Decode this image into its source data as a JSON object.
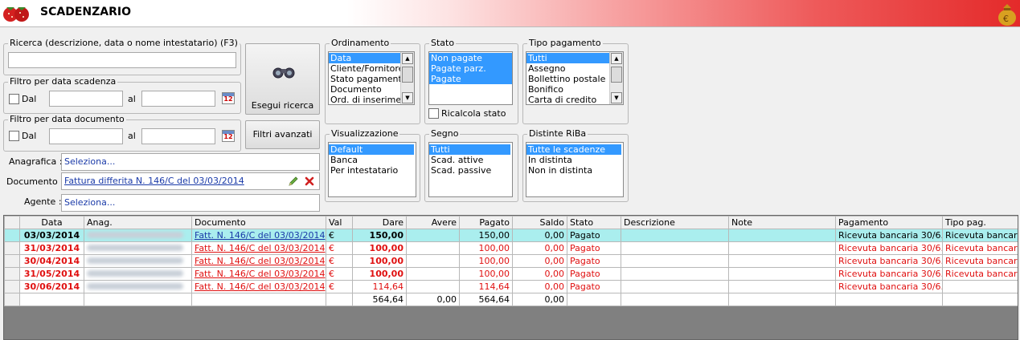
{
  "app": {
    "title": "SCADENZARIO"
  },
  "search": {
    "group_label": "Ricerca (descrizione, data o nome intestatario) (F3)",
    "value": "",
    "button_label": "Esegui ricerca"
  },
  "filter_scadenza": {
    "group_label": "Filtro per data scadenza",
    "from_label": "Dal",
    "to_label": "al",
    "from_checked": false
  },
  "filter_documento": {
    "group_label": "Filtro per data documento",
    "from_label": "Dal",
    "to_label": "al",
    "from_checked": false
  },
  "advanced_button": "Filtri avanzati",
  "anagrafica": {
    "label": "Anagrafica :",
    "value": "Seleziona..."
  },
  "documento": {
    "label": "Documento :",
    "value": "Fattura differita N. 146/C del 03/03/2014"
  },
  "agente": {
    "label": "Agente :",
    "value": "Seleziona..."
  },
  "ordinamento": {
    "group_label": "Ordinamento",
    "items": [
      "Data",
      "Cliente/Fornitore",
      "Stato pagamento",
      "Documento",
      "Ord. di inserimento"
    ],
    "selected": "Data"
  },
  "stato": {
    "group_label": "Stato",
    "items": [
      "Non pagate",
      "Pagate parz.",
      "Pagate"
    ],
    "ricalcola_label": "Ricalcola stato",
    "ricalcola_checked": false
  },
  "tipo_pagamento": {
    "group_label": "Tipo pagamento",
    "items": [
      "Tutti",
      "Assegno",
      "Bollettino postale",
      "Bonifico",
      "Carta di credito"
    ],
    "selected": "Tutti"
  },
  "visualizzazione": {
    "group_label": "Visualizzazione",
    "items": [
      "Default",
      "Banca",
      "Per intestatario"
    ],
    "selected": "Default"
  },
  "segno": {
    "group_label": "Segno",
    "items": [
      "Tutti",
      "Scad. attive",
      "Scad. passive"
    ],
    "selected": "Tutti"
  },
  "distinte": {
    "group_label": "Distinte RiBa",
    "items": [
      "Tutte le scadenze",
      "In distinta",
      "Non in distinta"
    ],
    "selected": "Tutte le scadenze"
  },
  "table": {
    "columns": [
      "Data",
      "Anag.",
      "Documento",
      "Val",
      "Dare",
      "Avere",
      "Pagato",
      "Saldo",
      "Stato",
      "Descrizione",
      "Note",
      "Pagamento",
      "Tipo pag."
    ],
    "rows": [
      {
        "data": "03/03/2014",
        "documento": "Fatt. N. 146/C del 03/03/2014",
        "val": "€",
        "dare": "150,00",
        "avere": "",
        "pagato": "150,00",
        "saldo": "0,00",
        "stato": "Pagato",
        "pagamento": "Ricevuta bancaria 30/6...",
        "tipo": "Ricevuta bancaria"
      },
      {
        "data": "31/03/2014",
        "documento": "Fatt. N. 146/C del 03/03/2014",
        "val": "€",
        "dare": "100,00",
        "avere": "",
        "pagato": "100,00",
        "saldo": "0,00",
        "stato": "Pagato",
        "pagamento": "Ricevuta bancaria 30/6...",
        "tipo": "Ricevuta bancaria"
      },
      {
        "data": "30/04/2014",
        "documento": "Fatt. N. 146/C del 03/03/2014",
        "val": "€",
        "dare": "100,00",
        "avere": "",
        "pagato": "100,00",
        "saldo": "0,00",
        "stato": "Pagato",
        "pagamento": "Ricevuta bancaria 30/6...",
        "tipo": "Ricevuta bancaria"
      },
      {
        "data": "31/05/2014",
        "documento": "Fatt. N. 146/C del 03/03/2014",
        "val": "€",
        "dare": "100,00",
        "avere": "",
        "pagato": "100,00",
        "saldo": "0,00",
        "stato": "Pagato",
        "pagamento": "Ricevuta bancaria 30/6...",
        "tipo": "Ricevuta bancaria"
      },
      {
        "data": "30/06/2014",
        "documento": "Fatt. N. 146/C del 03/03/2014",
        "val": "€",
        "dare": "114,64",
        "avere": "",
        "pagato": "114,64",
        "saldo": "0,00",
        "stato": "Pagato",
        "pagamento": "Ricevuta bancaria 30/6...",
        "tipo": ""
      }
    ],
    "totals": {
      "dare": "564,64",
      "avere": "0,00",
      "pagato": "564,64",
      "saldo": "0,00"
    }
  },
  "colors": {
    "accent_red": "#e01010",
    "selection_blue": "#3399ff",
    "selected_row": "#aaeeee",
    "link_blue": "#1a3aa8"
  },
  "icons": [
    "strawberry-logo-icon",
    "money-bag-icon",
    "binoculars-icon",
    "calendar-icon",
    "edit-pencil-icon",
    "delete-x-icon"
  ]
}
